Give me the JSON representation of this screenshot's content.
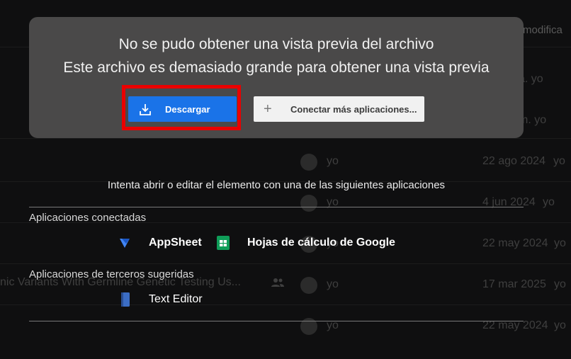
{
  "background": {
    "column_header": "modifica",
    "rows": [
      {
        "owner": "yo",
        "date": "",
        "show_avatar": false
      },
      {
        "owner": "yo",
        "date": "",
        "show_avatar": false
      },
      {
        "owner": "yo",
        "date": "22 ago 2024",
        "show_avatar": true
      },
      {
        "owner": "yo",
        "date": "4 jun 2024",
        "show_avatar": true
      },
      {
        "owner": "yo",
        "date": "22 may 2024",
        "show_avatar": true
      },
      {
        "owner": "yo",
        "date": "17 mar 2025",
        "show_avatar": true
      },
      {
        "owner": "yo",
        "date": "22 may 2024",
        "show_avatar": true
      }
    ],
    "partial_row_suffixes": [
      "a. yo",
      "m. yo"
    ],
    "filename_fragment": "nic Variants With Germline Genetic Testing Us..."
  },
  "card": {
    "line1": "No se pudo obtener una vista previa del archivo",
    "line2": "Este archivo es demasiado grande para obtener una vista previa",
    "download_label": "Descargar",
    "connect_label": "Conectar más aplicaciones...",
    "colors": {
      "download_bg": "#1a73e8",
      "highlight": "#ea0000"
    }
  },
  "apps_panel": {
    "prompt": "Intenta abrir o editar el elemento con una de las siguientes aplicaciones",
    "connected_label": "Aplicaciones conectadas",
    "connected_apps": [
      {
        "name": "AppSheet",
        "icon": "appsheet-icon"
      },
      {
        "name": "Hojas de cálculo de Google",
        "icon": "google-sheets-icon"
      }
    ],
    "suggested_label": "Aplicaciones de terceros sugeridas",
    "suggested_apps": [
      {
        "name": "Text Editor",
        "icon": "text-editor-icon"
      }
    ]
  }
}
